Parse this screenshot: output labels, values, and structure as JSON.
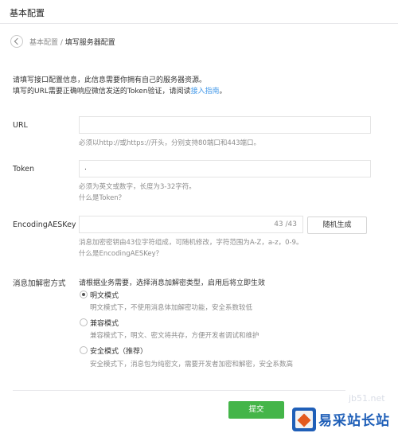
{
  "header": {
    "title": "基本配置"
  },
  "breadcrumb": {
    "parent": "基本配置",
    "separator": " / ",
    "current": "填写服务器配置"
  },
  "intro": {
    "line1": "请填写接口配置信息，此信息需要你拥有自己的服务器资源。",
    "line2_prefix": "填写的URL需要正确响应微信发送的Token验证，请阅读",
    "line2_link": "接入指南",
    "line2_suffix": "。"
  },
  "url_field": {
    "label": "URL",
    "value": "",
    "hint": "必须以http://或https://开头，分别支持80端口和443端口。"
  },
  "token_field": {
    "label": "Token",
    "value": ".",
    "hint": "必须为英文或数字，长度为3-32字符。",
    "help_link": "什么是Token？"
  },
  "aes_field": {
    "label": "EncodingAESKey",
    "value": "",
    "counter": "43 /43",
    "generate_button": "随机生成",
    "hint": "消息加密密钥由43位字符组成，可随机修改，字符范围为A-Z，a-z，0-9。",
    "help_link": "什么是EncodingAESKey？"
  },
  "encryption": {
    "label": "消息加解密方式",
    "instruction": "请根据业务需要，选择消息加解密类型，启用后将立即生效",
    "options": [
      {
        "label": "明文模式",
        "desc": "明文模式下，不使用消息体加解密功能，安全系数较低",
        "selected": true
      },
      {
        "label": "兼容模式",
        "desc": "兼容模式下，明文、密文将共存，方便开发者调试和维护",
        "selected": false
      },
      {
        "label": "安全模式（推荐）",
        "desc": "安全模式下，消息包为纯密文，需要开发者加密和解密，安全系数高",
        "selected": false
      }
    ]
  },
  "submit_button": "提交",
  "watermark": {
    "name": "易采站长站",
    "url": "jb51.net"
  },
  "colors": {
    "accent_green": "#44b549",
    "link_blue": "#459ae9",
    "watermark_blue": "#1f5fb8"
  }
}
